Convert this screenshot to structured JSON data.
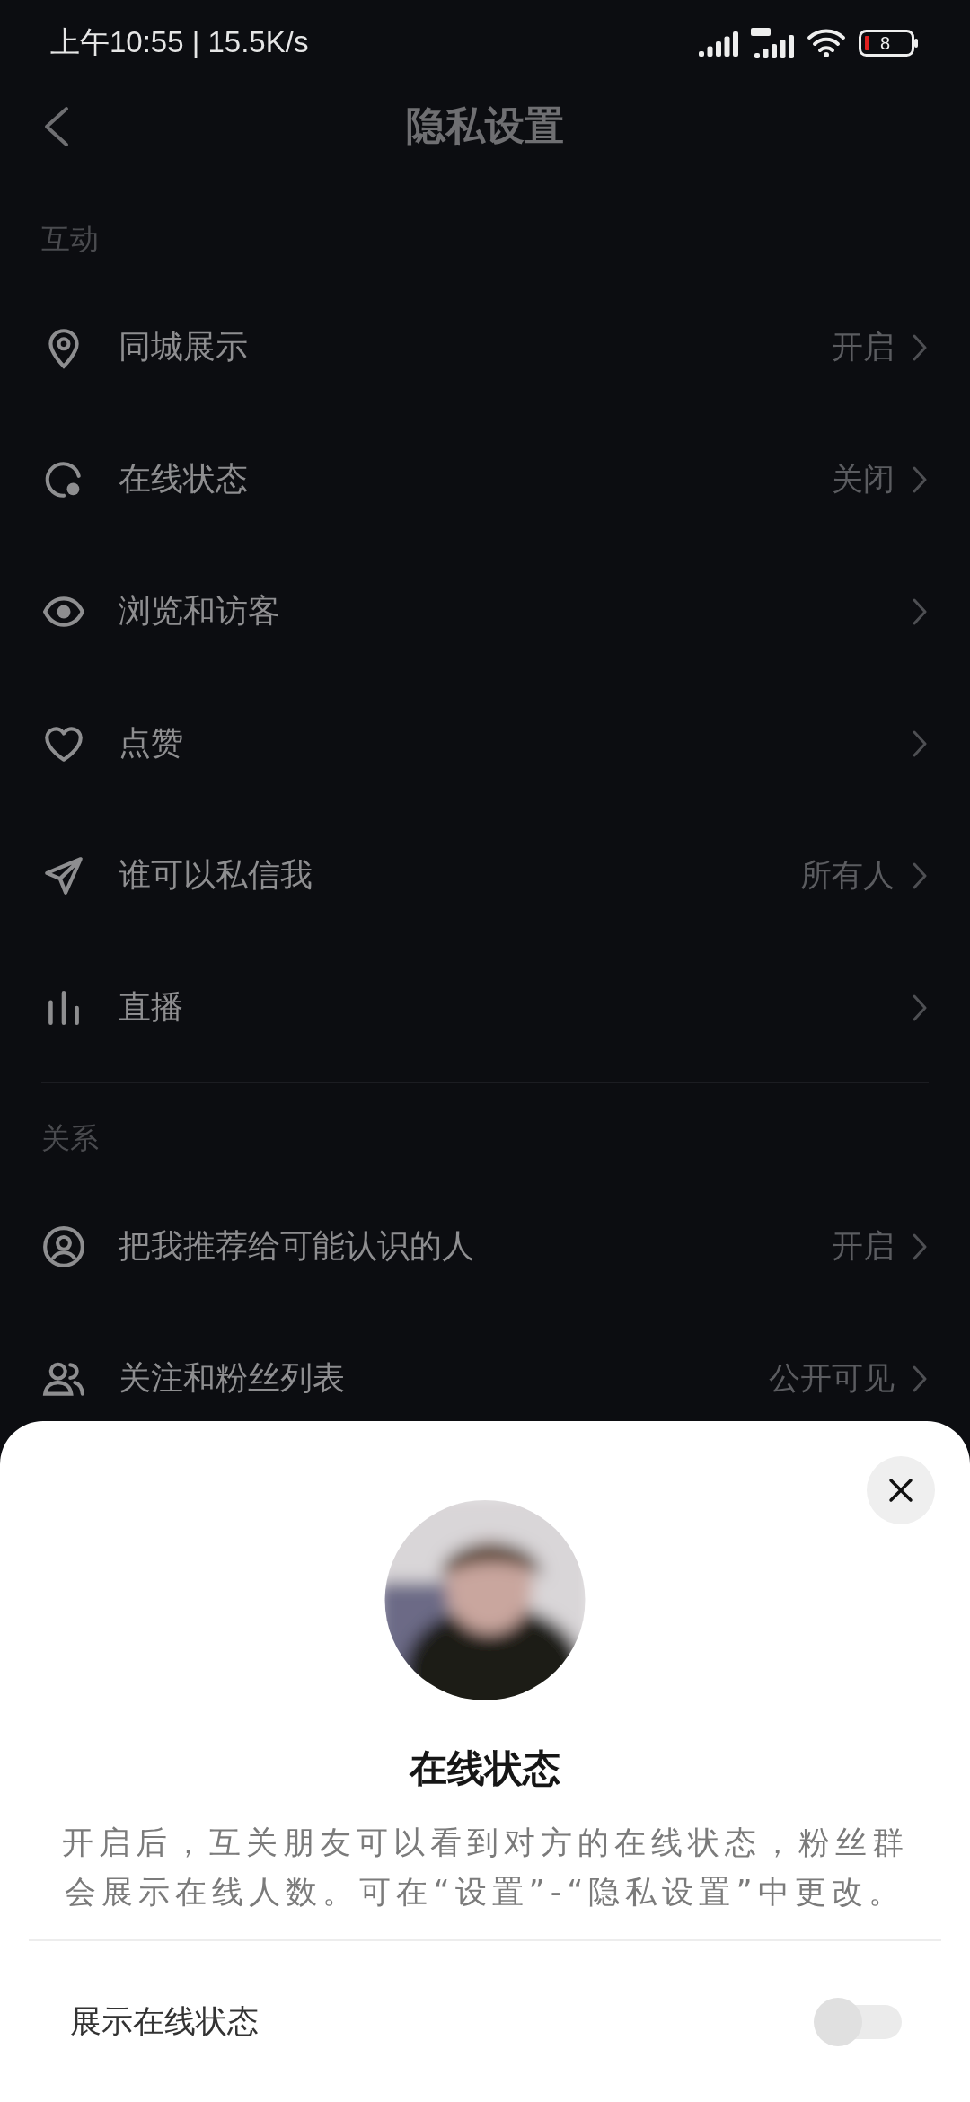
{
  "status_bar": {
    "time": "上午10:55 | 15.5K/s",
    "battery": "8"
  },
  "header": {
    "title": "隐私设置"
  },
  "sections": [
    {
      "title": "互动",
      "items": [
        {
          "kind": "pin",
          "label": "同城展示",
          "value": "开启"
        },
        {
          "kind": "online",
          "label": "在线状态",
          "value": "关闭"
        },
        {
          "kind": "eye",
          "label": "浏览和访客"
        },
        {
          "kind": "heart",
          "label": "点赞"
        },
        {
          "kind": "plane",
          "label": "谁可以私信我",
          "value": "所有人"
        },
        {
          "kind": "bars",
          "label": "直播"
        }
      ]
    },
    {
      "title": "关系",
      "items": [
        {
          "kind": "person",
          "label": "把我推荐给可能认识的人",
          "value": "开启"
        },
        {
          "kind": "people",
          "label": "关注和粉丝列表",
          "value": "公开可见"
        }
      ]
    }
  ],
  "sheet": {
    "title": "在线状态",
    "description": "开启后，互关朋友可以看到对方的在线状态，粉丝群会展示在线人数。可在“设置”-“隐私设置”中更改。",
    "toggle": {
      "label": "展示在线状态",
      "on": false
    }
  }
}
